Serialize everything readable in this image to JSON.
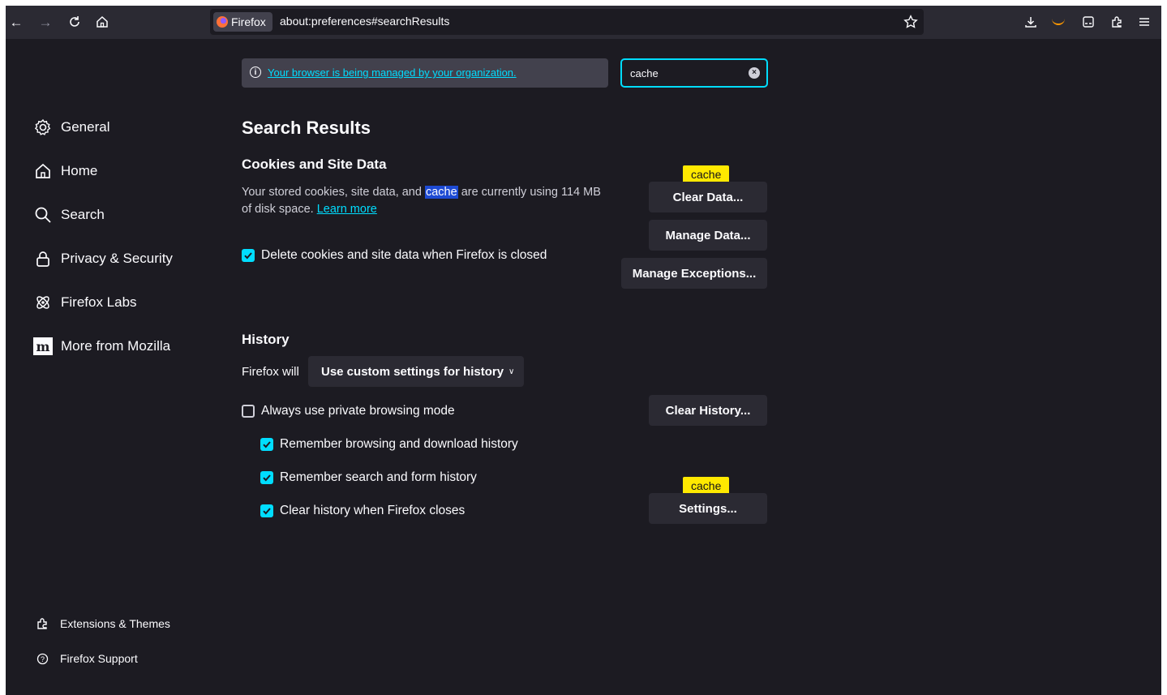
{
  "toolbar": {
    "brand": "Firefox",
    "url": "about:preferences#searchResults",
    "icons": [
      "back-icon",
      "forward-icon",
      "reload-icon",
      "home-icon",
      "bookmark-star-icon",
      "downloads-icon",
      "amazon-icon",
      "reader-icon",
      "extensions-icon",
      "menu-icon"
    ]
  },
  "notice": {
    "text": "Your browser is being managed by your organization."
  },
  "search": {
    "value": "cache"
  },
  "sidebar": {
    "items": [
      {
        "label": "General",
        "icon": "gear-icon"
      },
      {
        "label": "Home",
        "icon": "home-icon"
      },
      {
        "label": "Search",
        "icon": "search-icon"
      },
      {
        "label": "Privacy & Security",
        "icon": "lock-icon"
      },
      {
        "label": "Firefox Labs",
        "icon": "atom-icon"
      },
      {
        "label": "More from Mozilla",
        "icon": "mozilla-icon"
      }
    ],
    "footer": [
      {
        "label": "Extensions & Themes",
        "icon": "puzzle-icon"
      },
      {
        "label": "Firefox Support",
        "icon": "help-icon"
      }
    ]
  },
  "main": {
    "title": "Search Results",
    "cookies": {
      "heading": "Cookies and Site Data",
      "desc_before": "Your stored cookies, site data, and ",
      "desc_highlight": "cache",
      "desc_after": " are currently using 114 MB of disk space. ",
      "learn_more": "Learn more",
      "delete_on_close_label": "Delete cookies and site data when Firefox is closed",
      "delete_on_close_checked": true,
      "clear_data_button": "Clear Data...",
      "manage_data_button": "Manage Data...",
      "manage_exceptions_button": "Manage Exceptions...",
      "tooltip": "cache"
    },
    "history": {
      "heading": "History",
      "firefox_will_label": "Firefox will",
      "mode_selected": "Use custom settings for history",
      "clear_history_button": "Clear History...",
      "settings_button": "Settings...",
      "tooltip": "cache",
      "options": [
        {
          "label": "Always use private browsing mode",
          "checked": false
        },
        {
          "label": "Remember browsing and download history",
          "checked": true
        },
        {
          "label": "Remember search and form history",
          "checked": true
        },
        {
          "label": "Clear history when Firefox closes",
          "checked": true
        }
      ]
    }
  },
  "colors": {
    "background": "#1c1b22",
    "accent": "#00ddff",
    "highlight": "#ffe900"
  }
}
